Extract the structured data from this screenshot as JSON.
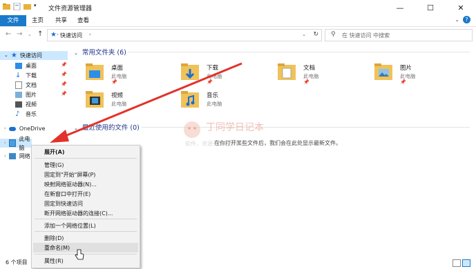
{
  "window": {
    "title": "文件资源管理器",
    "controls": [
      "—",
      "☐",
      "✕"
    ]
  },
  "ribbon": {
    "tabs": [
      "文件",
      "主页",
      "共享",
      "查看"
    ]
  },
  "address": {
    "path": "快速访问",
    "search_placeholder": "在 快速访问 中搜索"
  },
  "sidebar": {
    "quick_access": "快速访问",
    "items": [
      "桌面",
      "下载",
      "文档",
      "图片",
      "视频",
      "音乐"
    ],
    "onedrive": "OneDrive",
    "this_pc": "此电脑",
    "network": "网络"
  },
  "content": {
    "frequent_header": "常用文件夹 (6)",
    "recent_header": "最近使用的文件 (0)",
    "recent_empty": "在你打开某些文件后，我们会在此处显示最新文件。",
    "folders": [
      {
        "name": "桌面",
        "sub": "此电脑",
        "pinned": true,
        "icon": "desktop-folder"
      },
      {
        "name": "下载",
        "sub": "此电脑",
        "pinned": true,
        "icon": "download-folder"
      },
      {
        "name": "文档",
        "sub": "此电脑",
        "pinned": true,
        "icon": "documents-folder"
      },
      {
        "name": "图片",
        "sub": "此电脑",
        "pinned": true,
        "icon": "pictures-folder"
      },
      {
        "name": "视频",
        "sub": "此电脑",
        "pinned": false,
        "icon": "videos-folder"
      },
      {
        "name": "音乐",
        "sub": "此电脑",
        "pinned": false,
        "icon": "music-folder"
      }
    ]
  },
  "context_menu": {
    "items": [
      "展开(A)",
      "管理(G)",
      "固定到\"开始\"屏幕(P)",
      "映射网络驱动器(N)...",
      "在新窗口中打开(E)",
      "固定到快速访问",
      "断开网络驱动器的连接(C)...",
      "添加一个网络位置(L)",
      "删除(D)",
      "重命名(M)",
      "属性(R)"
    ]
  },
  "status": {
    "count": "6 个项目"
  },
  "watermark": {
    "title": "丁同学日记本",
    "subtitle": "软件，资源，学习分享"
  },
  "colors": {
    "accent": "#1979ca",
    "highlight": "#cce8ff",
    "section_header": "#1e3287",
    "arrow": "#e2322b"
  }
}
